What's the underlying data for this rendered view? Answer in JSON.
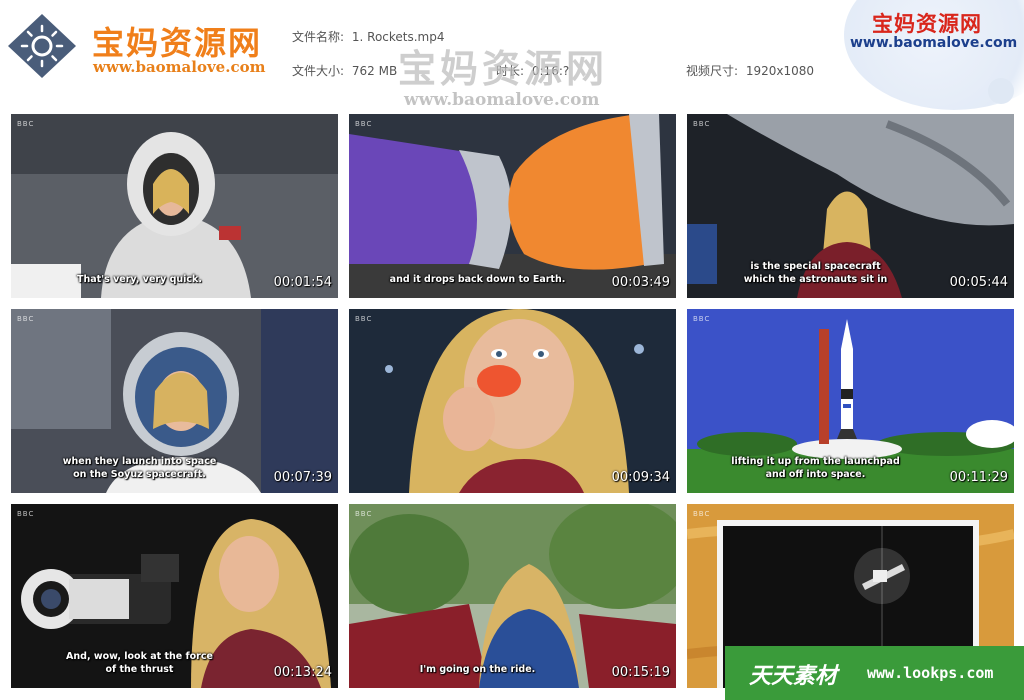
{
  "header": {
    "logo_cn": "宝妈资源网",
    "logo_url": "www.baomalove.com",
    "file_name_label": "文件名称:",
    "file_name_value": "1. Rockets.mp4",
    "file_size_label": "文件大小:",
    "file_size_value": "762 MB",
    "duration_label": "时长:",
    "duration_value": "0:16:?",
    "dimension_label": "视频尺寸:",
    "dimension_value": "1920x1080",
    "watermark_cn": "宝妈资源网",
    "watermark_url": "www.baomalove.com",
    "top_right_cn": "宝妈资源网",
    "top_right_url": "www.baomalove.com"
  },
  "thumbnails": [
    {
      "subtitle": "That's very, very quick.",
      "timestamp": "00:01:54",
      "brand": "BBC"
    },
    {
      "subtitle": "and it drops back down to Earth.",
      "timestamp": "00:03:49",
      "brand": "BBC"
    },
    {
      "subtitle": "is the special spacecraft\nwhich the astronauts sit in",
      "timestamp": "00:05:44",
      "brand": "BBC"
    },
    {
      "subtitle": "when they launch into space\non the Soyuz spacecraft.",
      "timestamp": "00:07:39",
      "brand": "BBC"
    },
    {
      "subtitle": "",
      "timestamp": "00:09:34",
      "brand": "BBC"
    },
    {
      "subtitle": "lifting it up from the launchpad\nand off into space.",
      "timestamp": "00:11:29",
      "brand": "BBC"
    },
    {
      "subtitle": "And, wow, look at the force\nof the thrust",
      "timestamp": "00:13:24",
      "brand": "BBC"
    },
    {
      "subtitle": "I'm going on the ride.",
      "timestamp": "00:15:19",
      "brand": "BBC"
    },
    {
      "subtitle": "",
      "timestamp": "",
      "brand": "BBC"
    }
  ],
  "footer_banner": {
    "cn": "天天素材",
    "url": "www.lookps.com"
  },
  "colors": {
    "logo_orange": "#f07f1a",
    "logo_badge": "#4a5d7a",
    "top_right_red": "#d9261c",
    "top_right_blue": "#1c3f8c",
    "banner_green": "#3a9b3a"
  }
}
